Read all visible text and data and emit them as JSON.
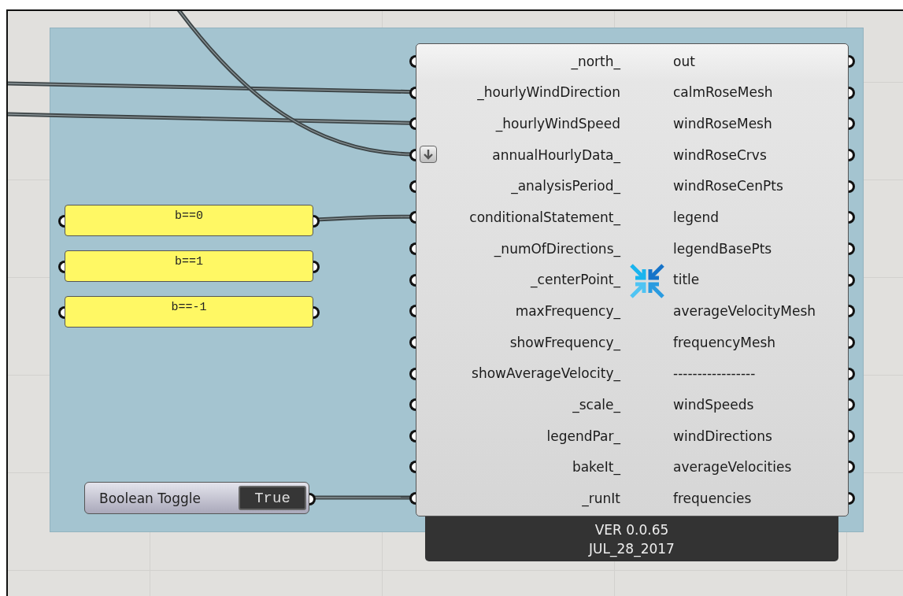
{
  "component": {
    "inputs": [
      {
        "name": "_north_",
        "flag": false
      },
      {
        "name": "_hourlyWindDirection",
        "flag": false
      },
      {
        "name": "_hourlyWindSpeed",
        "flag": false
      },
      {
        "name": "annualHourlyData_",
        "flag": true
      },
      {
        "name": "_analysisPeriod_",
        "flag": false
      },
      {
        "name": "conditionalStatement_",
        "flag": false
      },
      {
        "name": "_numOfDirections_",
        "flag": false
      },
      {
        "name": "_centerPoint_",
        "flag": false
      },
      {
        "name": "maxFrequency_",
        "flag": false
      },
      {
        "name": "showFrequency_",
        "flag": false
      },
      {
        "name": "showAverageVelocity_",
        "flag": false
      },
      {
        "name": "_scale_",
        "flag": false
      },
      {
        "name": "legendPar_",
        "flag": false
      },
      {
        "name": "bakeIt_",
        "flag": false
      },
      {
        "name": "_runIt",
        "flag": false
      }
    ],
    "outputs": [
      "out",
      "calmRoseMesh",
      "windRoseMesh",
      "windRoseCrvs",
      "windRoseCenPts",
      "legend",
      "legendBasePts",
      "title",
      "averageVelocityMesh",
      "frequencyMesh",
      "-----------------",
      "windSpeeds",
      "windDirections",
      "averageVelocities",
      "frequencies"
    ],
    "version": [
      "VER 0.0.65",
      "JUL_28_2017"
    ]
  },
  "panels": [
    "b==0",
    "b==1",
    "b==-1"
  ],
  "toggle": {
    "label": "Boolean Toggle",
    "value": "True"
  }
}
